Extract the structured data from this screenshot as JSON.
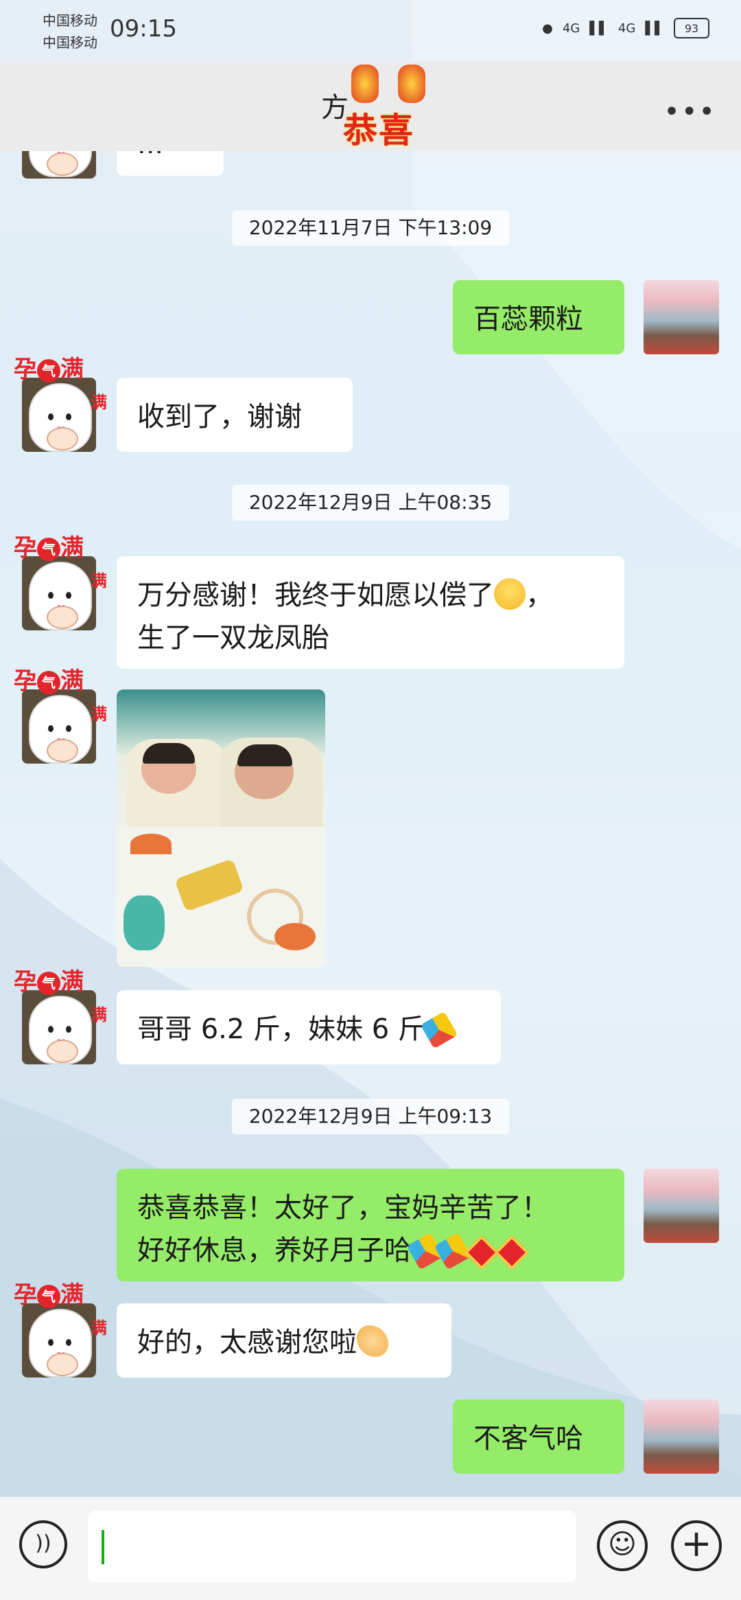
{
  "status_bar": {
    "carrier_1": "中国移动",
    "carrier_2": "中国移动",
    "time": "09:15",
    "signal_1": "4G",
    "signal_2": "4G",
    "battery": "93"
  },
  "header": {
    "title": "方",
    "decoration_text": "恭喜",
    "more_icon": "more-dots-icon"
  },
  "partial_top_message": "...",
  "messages": [
    {
      "kind": "time",
      "text": "2022年11月7日 下午13:09"
    },
    {
      "kind": "out",
      "text": "百蕊颗粒"
    },
    {
      "kind": "in",
      "text": "收到了，谢谢"
    },
    {
      "kind": "time",
      "text": "2022年12月9日 上午08:35"
    },
    {
      "kind": "in",
      "text_line1": "万分感谢！我终于如愿以偿了",
      "text_line1_end": "，",
      "text_line2": "生了一双龙凤胎",
      "emoji": "grinning-face-icon"
    },
    {
      "kind": "in-image",
      "image_desc": "twin-babies-photo"
    },
    {
      "kind": "in",
      "text": "哥哥 6.2 斤，妹妹 6 斤",
      "emoji": "party-popper-icon"
    },
    {
      "kind": "time",
      "text": "2022年12月9日 上午09:13"
    },
    {
      "kind": "out",
      "text_line1": "恭喜恭喜！太好了，宝妈辛苦了！",
      "text_line2": "好好休息，养好月子哈",
      "emojis": [
        "party-popper-icon",
        "party-popper-icon",
        "fu-icon",
        "fu-icon"
      ]
    },
    {
      "kind": "in",
      "text": "好的，太感谢您啦",
      "emoji": "handshake-icon"
    },
    {
      "kind": "out",
      "text": "不客气哈"
    }
  ],
  "avatar_badge": {
    "left": "孕",
    "mid": "气",
    "right": "满",
    "sub": "满"
  },
  "bottom_bar": {
    "voice_icon": "voice-icon",
    "input_value": "",
    "emoji_icon": "emoji-icon",
    "plus_icon": "plus-icon"
  }
}
